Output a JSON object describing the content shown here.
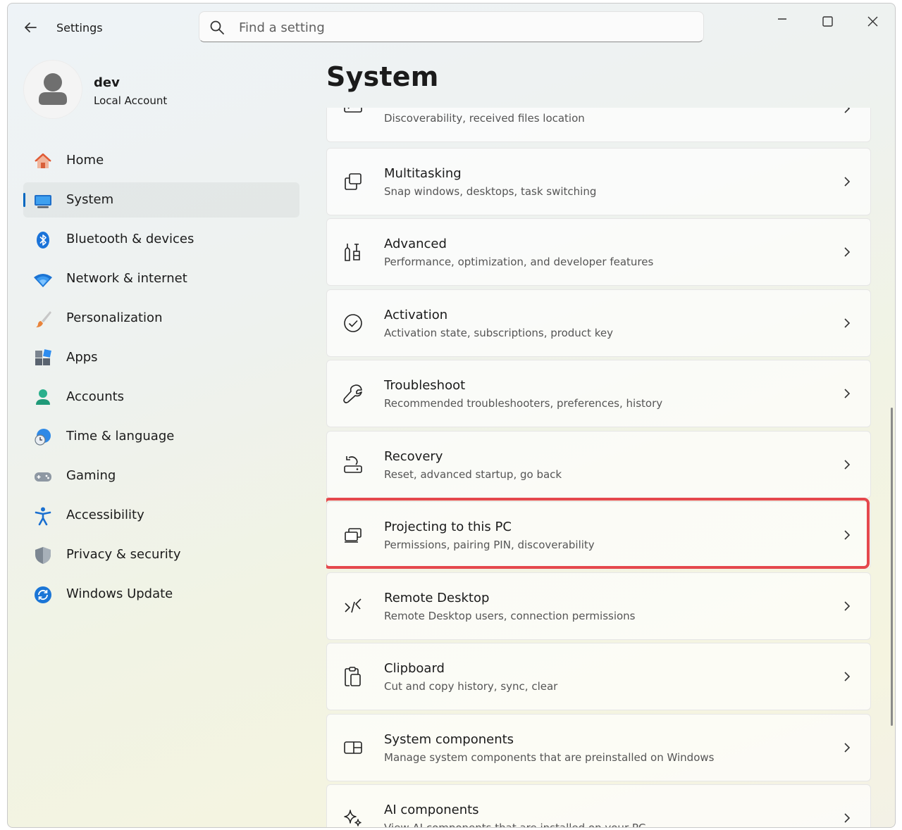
{
  "titlebar": {
    "app_title": "Settings",
    "back_icon": "arrow-left-icon",
    "minimize_icon": "minimize-icon",
    "maximize_icon": "maximize-icon",
    "close_icon": "close-icon"
  },
  "search": {
    "placeholder": "Find a setting",
    "value": "",
    "icon": "search-icon"
  },
  "profile": {
    "name": "dev",
    "account_type": "Local Account",
    "icon": "user-avatar-icon"
  },
  "sidebar": {
    "items": [
      {
        "label": "Home",
        "icon": "home-icon",
        "selected": false
      },
      {
        "label": "System",
        "icon": "system-monitor-icon",
        "selected": true
      },
      {
        "label": "Bluetooth & devices",
        "icon": "bluetooth-icon",
        "selected": false
      },
      {
        "label": "Network & internet",
        "icon": "wifi-icon",
        "selected": false
      },
      {
        "label": "Personalization",
        "icon": "paintbrush-icon",
        "selected": false
      },
      {
        "label": "Apps",
        "icon": "apps-icon",
        "selected": false
      },
      {
        "label": "Accounts",
        "icon": "person-icon",
        "selected": false
      },
      {
        "label": "Time & language",
        "icon": "globe-clock-icon",
        "selected": false
      },
      {
        "label": "Gaming",
        "icon": "gamepad-icon",
        "selected": false
      },
      {
        "label": "Accessibility",
        "icon": "accessibility-icon",
        "selected": false
      },
      {
        "label": "Privacy & security",
        "icon": "shield-icon",
        "selected": false
      },
      {
        "label": "Windows Update",
        "icon": "refresh-icon",
        "selected": false
      }
    ]
  },
  "main": {
    "title": "System",
    "cards": [
      {
        "title": "",
        "description": "Discoverability, received files location",
        "icon": "nearby-sharing-icon"
      },
      {
        "title": "Multitasking",
        "description": "Snap windows, desktops, task switching",
        "icon": "multitasking-icon"
      },
      {
        "title": "Advanced",
        "description": "Performance, optimization, and developer features",
        "icon": "tools-icon"
      },
      {
        "title": "Activation",
        "description": "Activation state, subscriptions, product key",
        "icon": "check-circle-icon"
      },
      {
        "title": "Troubleshoot",
        "description": "Recommended troubleshooters, preferences, history",
        "icon": "wrench-icon"
      },
      {
        "title": "Recovery",
        "description": "Reset, advanced startup, go back",
        "icon": "recovery-icon"
      },
      {
        "title": "Projecting to this PC",
        "description": "Permissions, pairing PIN, discoverability",
        "icon": "projecting-icon",
        "highlighted": true
      },
      {
        "title": "Remote Desktop",
        "description": "Remote Desktop users, connection permissions",
        "icon": "remote-desktop-icon"
      },
      {
        "title": "Clipboard",
        "description": "Cut and copy history, sync, clear",
        "icon": "clipboard-icon"
      },
      {
        "title": "System components",
        "description": "Manage system components that are preinstalled on Windows",
        "icon": "system-components-icon"
      },
      {
        "title": "AI components",
        "description": "View AI components that are installed on your PC",
        "icon": "sparkle-icon"
      }
    ],
    "chevron_icon": "chevron-right-icon"
  },
  "colors": {
    "accent": "#0067c0",
    "highlight_border": "#e5484d"
  }
}
